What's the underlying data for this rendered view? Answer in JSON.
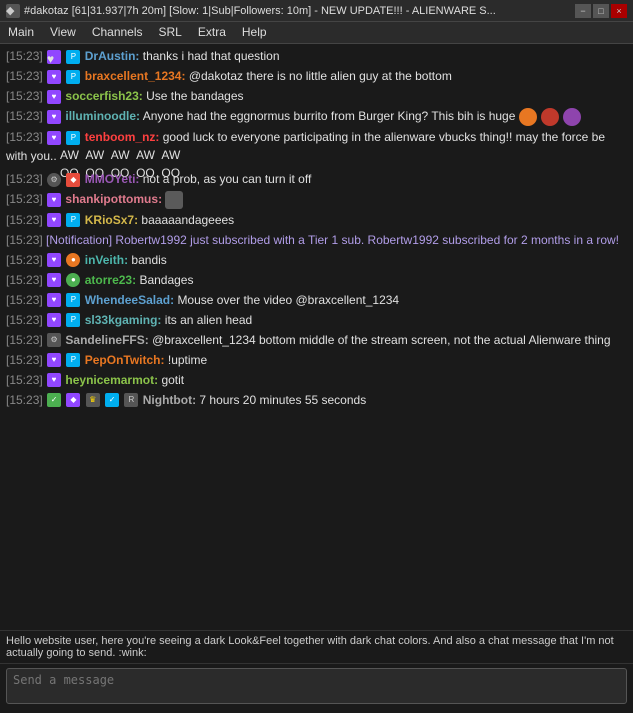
{
  "titlebar": {
    "title": "#dakotaz [61|31.937|7h 20m] [Slow: 1|Sub|Followers: 10m] - NEW UPDATE!!! - ALIENWARE S...",
    "icon": "◆",
    "controls": [
      "−",
      "□",
      "×"
    ]
  },
  "menubar": {
    "items": [
      "Main",
      "View",
      "Channels",
      "SRL",
      "Extra",
      "Help"
    ]
  },
  "messages": [
    {
      "time": "[15:23]",
      "badges": [
        "sub"
      ],
      "username": "DrAustin:",
      "username_color": "c-blue",
      "text": " thanks i had that question"
    },
    {
      "time": "[15:23]",
      "badges": [
        "sub"
      ],
      "username": "braxcellent_1234:",
      "username_color": "c-orange",
      "text": " @dakotaz there is no little alien guy at the bottom"
    },
    {
      "time": "[15:23]",
      "badges": [],
      "username": "soccerfish23:",
      "username_color": "c-lime",
      "text": " Use the bandages"
    },
    {
      "time": "[15:23]",
      "badges": [],
      "username": "illuminoodle:",
      "username_color": "c-cyan",
      "text": " Anyone had the eggnormus burrito from Burger King? This bih is huge",
      "has_emotes": true,
      "emote_type": "face"
    },
    {
      "time": "[15:23]",
      "badges": [
        "sub"
      ],
      "username": "tenboom_nz:",
      "username_color": "c-red",
      "text": " good luck to everyone participating in the alienware vbucks thing!! may the force be with you..",
      "has_awoo": true
    },
    {
      "time": "[15:23]",
      "badges": [
        "bot"
      ],
      "username": "MMOYeti:",
      "username_color": "c-purple",
      "text": " not a prob, as you can turn it off"
    },
    {
      "time": "[15:23]",
      "badges": [],
      "username": "shankipottomus:",
      "username_color": "c-pink",
      "text": "",
      "has_emote_small": true
    },
    {
      "time": "[15:23]",
      "badges": [
        "sub"
      ],
      "username": "KRioSx7:",
      "username_color": "c-yellow",
      "text": " baaaaandageees"
    },
    {
      "time": "[15:23]",
      "system": true,
      "text": "[Notification] Robertw1992 just subscribed with a Tier 1 sub. Robertw1992 subscribed for 2 months in a row!"
    },
    {
      "time": "[15:23]",
      "badges": [
        "sub"
      ],
      "username": "inVeith:",
      "username_color": "c-teal",
      "text": " bandis"
    },
    {
      "time": "[15:23]",
      "badges": [
        "green-circle"
      ],
      "username": "atorre23:",
      "username_color": "c-green",
      "text": " Bandages"
    },
    {
      "time": "[15:23]",
      "badges": [
        "sub"
      ],
      "username": "WhendeeSalad:",
      "username_color": "c-blue",
      "text": " Mouse over the video @braxcellent_1234"
    },
    {
      "time": "[15:23]",
      "badges": [
        "sub"
      ],
      "username": "sl33kgaming:",
      "username_color": "c-cyan",
      "text": " its an alien head"
    },
    {
      "time": "[15:23]",
      "badges": [
        "bot"
      ],
      "username": "SandelineFFS:",
      "username_color": "c-gray",
      "text": " @braxcellent_1234 bottom middle of the stream screen, not the actual Alienware thing"
    },
    {
      "time": "[15:23]",
      "badges": [
        "sub"
      ],
      "username": "PepOnTwitch:",
      "username_color": "c-orange",
      "text": " !uptime"
    },
    {
      "time": "[15:23]",
      "badges": [],
      "username": "heynicemarmot:",
      "username_color": "c-lime",
      "text": " gotit"
    },
    {
      "time": "[15:23]",
      "badges": [
        "check-green",
        "bits",
        "bot-crown",
        "check-blue",
        "bot"
      ],
      "username": "Nightbot:",
      "username_color": "c-gray",
      "text": " 7 hours 20 minutes 55 seconds"
    }
  ],
  "bottom_notice": "Hello website user, here you're seeing a dark Look&Feel together with dark chat colors. And also a chat message that I'm not actually going to send. :wink:",
  "input_placeholder": ""
}
